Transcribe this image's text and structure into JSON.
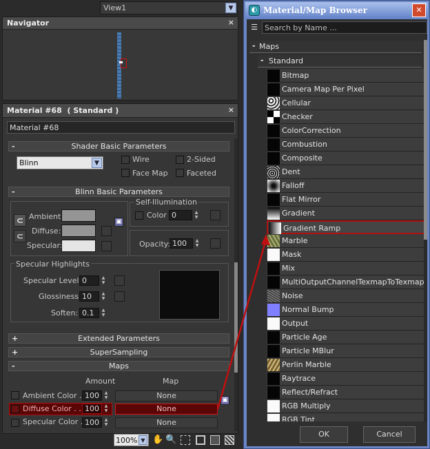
{
  "viewport_select": {
    "value": "View1"
  },
  "navigator": {
    "title": "Navigator",
    "close": "×"
  },
  "material_panel": {
    "title": "Material #68  ( Standard )",
    "close": "×",
    "name_value": "Material #68"
  },
  "shader": {
    "title": "Shader Basic Parameters",
    "shader_value": "Blinn",
    "wire": "Wire",
    "two_sided": "2-Sided",
    "face_map": "Face Map",
    "faceted": "Faceted"
  },
  "blinn": {
    "title": "Blinn Basic Parameters",
    "ambient": "Ambient:",
    "diffuse": "Diffuse:",
    "specular": "Specular:",
    "self_illum": "Self-Illumination",
    "color": "Color",
    "color_value": "0",
    "opacity": "Opacity:",
    "opacity_value": "100"
  },
  "highlights": {
    "title": "Specular Highlights",
    "level": "Specular Level:",
    "level_value": "0",
    "gloss": "Glossiness:",
    "gloss_value": "10",
    "soften": "Soften:",
    "soften_value": "0.1"
  },
  "rollups": {
    "extended": "Extended Parameters",
    "supersampling": "SuperSampling",
    "maps": "Maps"
  },
  "maps_table": {
    "amount_header": "Amount",
    "map_header": "Map",
    "rows": [
      {
        "label": "Ambient Color . . .",
        "amount": "100",
        "map": "None"
      },
      {
        "label": "Diffuse Color . . .",
        "amount": "100",
        "map": "None"
      },
      {
        "label": "Specular Color .",
        "amount": "100",
        "map": "None"
      }
    ]
  },
  "status_bar": {
    "zoom": "100%"
  },
  "browser": {
    "title": "Material/Map Browser",
    "search_placeholder": "Search by Name ...",
    "group_maps": "Maps",
    "group_standard": "Standard",
    "items": [
      "Bitmap",
      "Camera Map Per Pixel",
      "Cellular",
      "Checker",
      "ColorCorrection",
      "Combustion",
      "Composite",
      "Dent",
      "Falloff",
      "Flat Mirror",
      "Gradient",
      "Gradient Ramp",
      "Marble",
      "Mask",
      "Mix",
      "MultiOutputChannelTexmapToTexmap",
      "Noise",
      "Normal Bump",
      "Output",
      "Particle Age",
      "Particle MBlur",
      "Perlin Marble",
      "Raytrace",
      "Reflect/Refract",
      "RGB Multiply",
      "RGB Tint"
    ],
    "ok": "OK",
    "cancel": "Cancel"
  },
  "colors": {
    "highlight_red": "#b01010",
    "normal_bump_thumb": "#7f7fff"
  }
}
